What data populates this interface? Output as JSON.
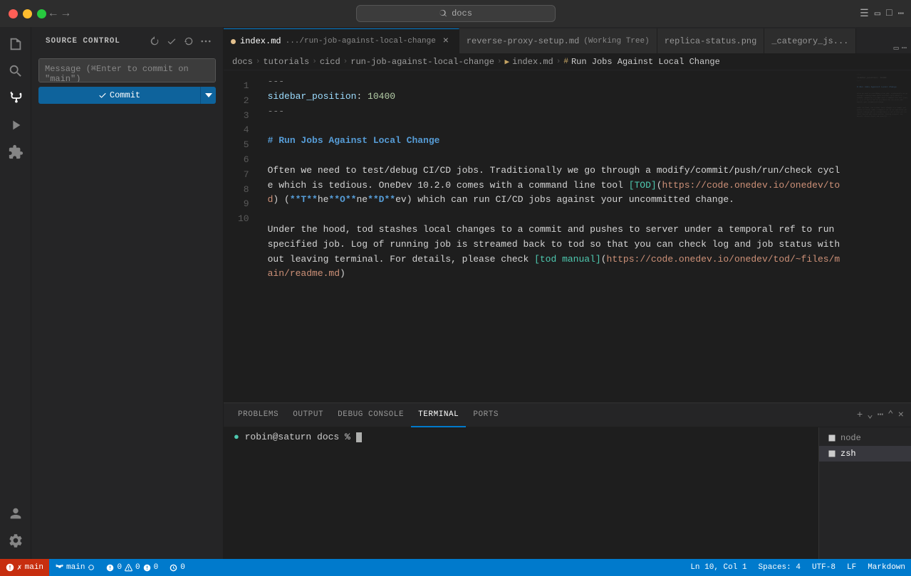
{
  "titlebar": {
    "search_placeholder": "docs",
    "nav_back": "←",
    "nav_forward": "→"
  },
  "sidebar": {
    "title": "SOURCE CONTROL",
    "commit_placeholder": "Message (⌘Enter to commit on \"main\")",
    "commit_label": "Commit",
    "branch": "main"
  },
  "tabs": [
    {
      "id": "index",
      "label": "index.md",
      "sublabel": ".../run-job-against-local-change",
      "active": true,
      "modified": true
    },
    {
      "id": "reverse-proxy",
      "label": "reverse-proxy-setup.md",
      "sublabel": "Working Tree",
      "active": false,
      "modified": false
    },
    {
      "id": "replica-status",
      "label": "replica-status.png",
      "active": false,
      "modified": false
    },
    {
      "id": "category",
      "label": "_category_js...",
      "active": false,
      "modified": false
    }
  ],
  "breadcrumb": {
    "items": [
      "docs",
      "tutorials",
      "cicd",
      "run-job-against-local-change",
      "index.md",
      "# Run Jobs Against Local Change"
    ]
  },
  "editor": {
    "lines": [
      {
        "num": 1,
        "content": "---",
        "type": "frontmatter"
      },
      {
        "num": 2,
        "content": "sidebar_position: 10400",
        "type": "frontmatter-kv"
      },
      {
        "num": 3,
        "content": "---",
        "type": "frontmatter"
      },
      {
        "num": 4,
        "content": "",
        "type": "empty"
      },
      {
        "num": 5,
        "content": "# Run Jobs Against Local Change",
        "type": "heading"
      },
      {
        "num": 6,
        "content": "",
        "type": "empty"
      },
      {
        "num": 7,
        "content": "Often we need to test/debug CI/CD jobs. Traditionally we go through a modify/commit/push/run/check cycle which is tedious. OneDev 10.2.0 comes with a command line tool [TOD](https://code.onedev.io/onedev/tod) (**T**he**O**ne**D**ev) which can run CI/CD jobs against your uncommitted change.",
        "type": "text-wrap"
      },
      {
        "num": 8,
        "content": "",
        "type": "empty"
      },
      {
        "num": 9,
        "content": "Under the hood, tod stashes local changes to a commit and pushes to server under a temporal ref to run specified job. Log of running job is streamed back to tod so that you can check log and job status without leaving terminal. For details, please check [tod manual](https://code.onedev.io/onedev/tod/~files/main/readme.md)",
        "type": "text-wrap"
      },
      {
        "num": 10,
        "content": "",
        "type": "empty"
      }
    ]
  },
  "panel": {
    "tabs": [
      "PROBLEMS",
      "OUTPUT",
      "DEBUG CONSOLE",
      "TERMINAL",
      "PORTS"
    ],
    "active_tab": "TERMINAL",
    "terminal_prompt": "robin@saturn docs % ",
    "terminal_items": [
      "node",
      "zsh"
    ]
  },
  "statusbar": {
    "branch": "main",
    "errors": "0",
    "warnings": "0",
    "info": "0",
    "position": "Ln 10, Col 1",
    "spaces": "Spaces: 4",
    "encoding": "UTF-8",
    "line_ending": "LF",
    "language": "Markdown"
  }
}
